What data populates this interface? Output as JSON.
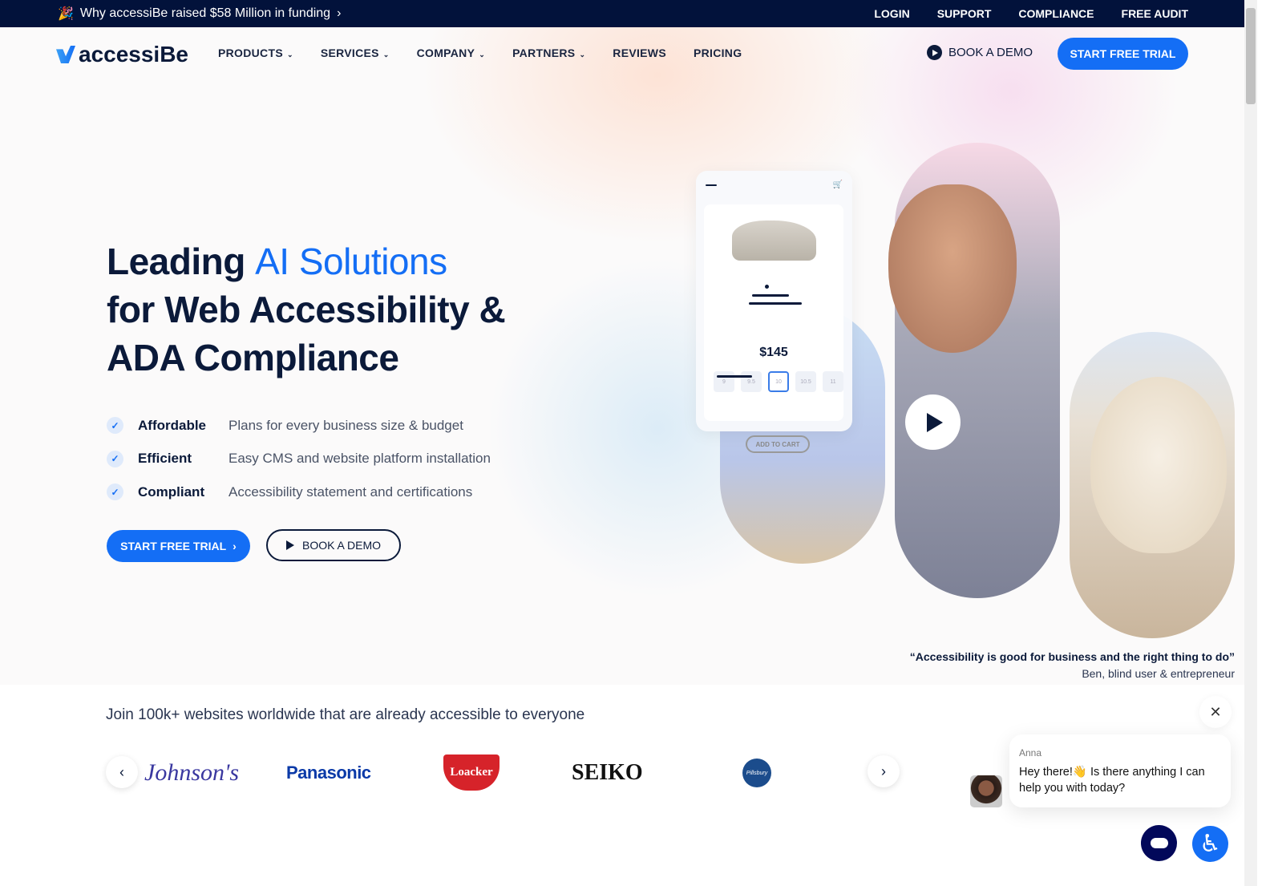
{
  "topbar": {
    "promo_icon": "party-popper-icon",
    "promo": "Why accessiBe raised $58 Million in funding",
    "links": [
      "LOGIN",
      "SUPPORT",
      "COMPLIANCE",
      "FREE AUDIT"
    ]
  },
  "nav": {
    "logo": "accessiBe",
    "items": [
      {
        "label": "PRODUCTS",
        "dropdown": true
      },
      {
        "label": "SERVICES",
        "dropdown": true
      },
      {
        "label": "COMPANY",
        "dropdown": true
      },
      {
        "label": "PARTNERS",
        "dropdown": true
      },
      {
        "label": "REVIEWS"
      },
      {
        "label": "PRICING"
      }
    ],
    "book_demo": "BOOK A DEMO",
    "start_trial": "START FREE TRIAL"
  },
  "hero": {
    "title_a": "Leading ",
    "title_highlight": "AI Solutions",
    "title_b": "for Web Accessibility &",
    "title_c": "ADA Compliance",
    "features": [
      {
        "name": "Affordable",
        "desc": "Plans for every business size & budget"
      },
      {
        "name": "Efficient",
        "desc": "Easy CMS and website platform installation"
      },
      {
        "name": "Compliant",
        "desc": "Accessibility statement and certifications"
      }
    ],
    "cta_trial": "START FREE TRIAL",
    "cta_demo": "BOOK A DEMO"
  },
  "mockup": {
    "price": "$145",
    "sizes": [
      "9",
      "9.5",
      "10",
      "10.5",
      "11"
    ],
    "selected_size": "10",
    "add_to_cart": "ADD TO CART"
  },
  "quote": {
    "text": "“Accessibility is good for business and the right thing to do”",
    "author": "Ben, blind user & entrepreneur"
  },
  "brands": {
    "heading": "Join 100k+ websites worldwide that are already accessible to everyone",
    "logos": [
      "Johnson's",
      "Panasonic",
      "Loacker",
      "SEIKO",
      "Pillsbury"
    ]
  },
  "chat": {
    "agent": "Anna",
    "message": "Hey there!👋 Is there anything I can help you with today?"
  },
  "colors": {
    "accent": "#146ef5",
    "navy": "#02123b"
  }
}
